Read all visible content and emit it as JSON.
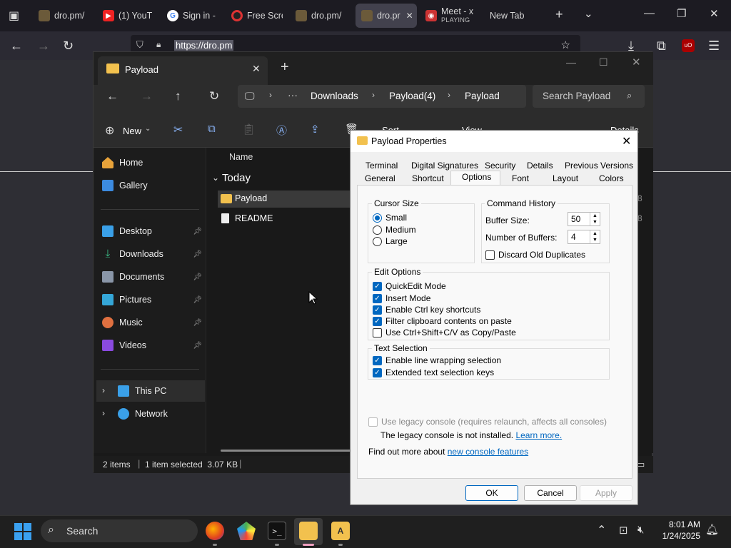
{
  "browser": {
    "tabs": [
      {
        "label": "dro.pm/"
      },
      {
        "label": "(1) YouT"
      },
      {
        "label": "Sign in -"
      },
      {
        "label": "Free Scre"
      },
      {
        "label": "dro.pm/"
      },
      {
        "label": "dro.pr"
      },
      {
        "label": "Meet - x",
        "sub": "PLAYING"
      },
      {
        "label": "New Tab"
      }
    ],
    "url": "https://dro.pm"
  },
  "explorer": {
    "tab_title": "Payload",
    "breadcrumb": [
      "Downloads",
      "Payload(4)",
      "Payload"
    ],
    "search_placeholder": "Search Payload",
    "toolbar": {
      "new_label": "New",
      "sort_label": "Sort",
      "view_label": "View",
      "details_label": "Details"
    },
    "sidebar": {
      "home": "Home",
      "gallery": "Gallery",
      "pinned": [
        "Desktop",
        "Downloads",
        "Documents",
        "Pictures",
        "Music",
        "Videos"
      ],
      "this_pc": "This PC",
      "network": "Network"
    },
    "column_name": "Name",
    "group_today": "Today",
    "files": [
      "Payload",
      "README"
    ],
    "status": {
      "items": "2 items",
      "selected": "1 item selected  3.07 KB"
    },
    "right_edge_values": [
      "8",
      "8"
    ]
  },
  "dialog": {
    "title": "Payload Properties",
    "tabs_row1": [
      "Terminal",
      "Digital Signatures",
      "Security",
      "Details",
      "Previous Versions"
    ],
    "tabs_row2": [
      "General",
      "Shortcut",
      "Options",
      "Font",
      "Layout",
      "Colors"
    ],
    "cursor_size": {
      "title": "Cursor Size",
      "options": [
        "Small",
        "Medium",
        "Large"
      ],
      "selected": "Small"
    },
    "command_history": {
      "title": "Command History",
      "buffer_size_label": "Buffer Size:",
      "buffer_size": "50",
      "num_buffers_label": "Number of Buffers:",
      "num_buffers": "4",
      "discard_label": "Discard Old Duplicates"
    },
    "edit_options": {
      "title": "Edit Options",
      "items": [
        {
          "label": "QuickEdit Mode",
          "checked": true
        },
        {
          "label": "Insert Mode",
          "checked": true
        },
        {
          "label": "Enable Ctrl key shortcuts",
          "checked": true
        },
        {
          "label": "Filter clipboard contents on paste",
          "checked": true
        },
        {
          "label": "Use Ctrl+Shift+C/V as Copy/Paste",
          "checked": false
        }
      ]
    },
    "text_selection": {
      "title": "Text Selection",
      "items": [
        {
          "label": "Enable line wrapping selection",
          "checked": true
        },
        {
          "label": "Extended text selection keys",
          "checked": true
        }
      ]
    },
    "legacy": {
      "checkbox_label": "Use legacy console (requires relaunch, affects all consoles)",
      "note_text": "The legacy console is not installed.",
      "learn_more": "Learn more.",
      "find_out": "Find out more about",
      "new_features_link": "new console features"
    },
    "buttons": {
      "ok": "OK",
      "cancel": "Cancel",
      "apply": "Apply"
    }
  },
  "taskbar": {
    "search_label": "Search",
    "time": "8:01 AM",
    "date": "1/24/2025"
  },
  "colors": {
    "accent": "#0067c0",
    "folder": "#f2c14e"
  }
}
